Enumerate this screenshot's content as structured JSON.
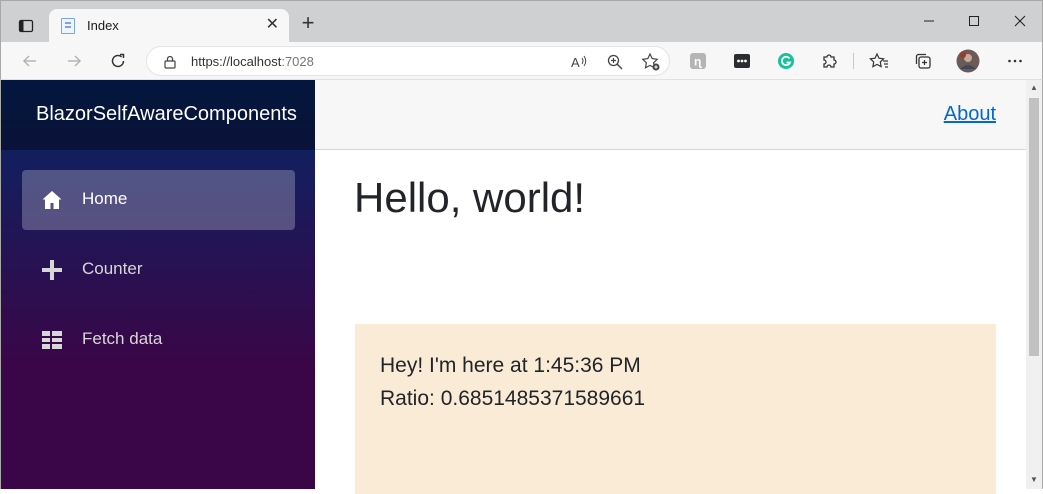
{
  "browser": {
    "tab_title": "Index",
    "url_host": "https://localhost",
    "url_port": ":7028",
    "tab_close": "✕",
    "new_tab": "+",
    "minimize": "—",
    "maximize": "☐",
    "close": "✕"
  },
  "app": {
    "brand": "BlazorSelfAwareComponents",
    "about": "About",
    "nav": [
      {
        "label": "Home",
        "icon": "home-icon",
        "active": true
      },
      {
        "label": "Counter",
        "icon": "plus-icon"
      },
      {
        "label": "Fetch data",
        "icon": "list-icon"
      }
    ],
    "heading": "Hello, world!",
    "message_line1": "Hey! I'm here at 1:45:36 PM",
    "message_line2": "Ratio: 0.6851485371589661"
  },
  "colors": {
    "link": "#0366d6",
    "panel": "#faebd7",
    "sidebar_top": "#052767",
    "sidebar_bottom": "#3a0647"
  }
}
